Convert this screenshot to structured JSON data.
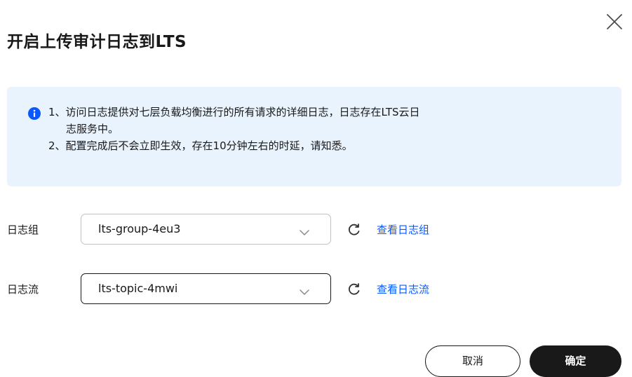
{
  "dialog": {
    "title": "开启上传审计日志到LTS",
    "close_icon": "close-icon"
  },
  "info": {
    "icon": "info-icon",
    "lines": [
      "1、访问日志提供对七层负载均衡进行的所有请求的详细日志，日志存在LTS云日",
      "志服务中。",
      "2、配置完成后不会立即生效，存在10分钟左右的时延，请知悉。"
    ]
  },
  "log_group": {
    "label": "日志组",
    "value": "lts-group-4eu3",
    "link": "查看日志组"
  },
  "log_stream": {
    "label": "日志流",
    "value": "lts-topic-4mwi",
    "link": "查看日志流"
  },
  "buttons": {
    "cancel": "取消",
    "confirm": "确定"
  },
  "colors": {
    "info_bg": "#e8f3fd",
    "info_icon": "#0a59ff",
    "link": "#0a59ff",
    "primary": "#191919"
  }
}
